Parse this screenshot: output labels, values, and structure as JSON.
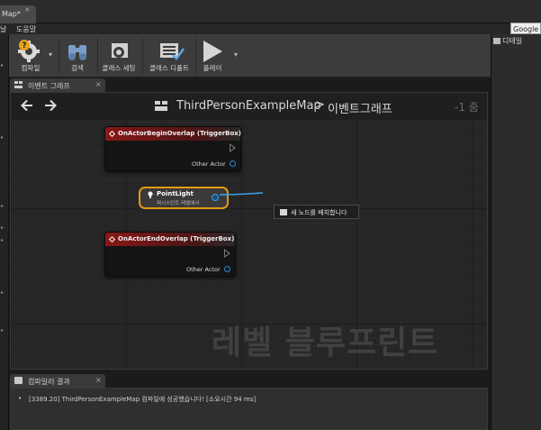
{
  "window": {
    "tab_label": "Map*",
    "tab_close": "×",
    "google_field": "Google"
  },
  "menu": {
    "items": [
      "날",
      "도움말"
    ]
  },
  "toolbar": {
    "buttons": [
      {
        "label": "컴파일",
        "icon": "compile-gear-icon"
      },
      {
        "label": "검색",
        "icon": "binoculars-icon"
      },
      {
        "label": "클래스 세팅",
        "icon": "gear-icon"
      },
      {
        "label": "클래스 디폴트",
        "icon": "checklist-icon"
      },
      {
        "label": "플레이",
        "icon": "play-icon"
      }
    ]
  },
  "details_panel": {
    "tab_label": "디테일"
  },
  "graph_tab": {
    "label": "이벤트 그래프",
    "close": "×"
  },
  "graph": {
    "breadcrumb_map": "ThirdPersonExampleMap",
    "breadcrumb_sep": ">",
    "breadcrumb_graph": "이벤트그래프",
    "zoom": "-1 줌",
    "watermark": "레벨 블루프린트",
    "nodes": {
      "begin_overlap": {
        "title": "OnActorBeginOverlap (TriggerBox)",
        "pin": "Other Actor"
      },
      "point_light": {
        "title": "PointLight",
        "subtitle": "퍼시스턴트 레벨에서"
      },
      "end_overlap": {
        "title": "OnActorEndOverlap (TriggerBox)",
        "pin": "Other Actor"
      }
    },
    "place_node_label": "새 노드를 배치합니다"
  },
  "results": {
    "tab_label": "컴파일러 결과",
    "close": "×",
    "message": "[3389.20] ThirdPersonExampleMap 컴파일에 성공했습니다! [소요시간 94 ms]"
  },
  "colors": {
    "event_header": "#8a1717",
    "selected_border": "#e39a16",
    "object_pin": "#1f8fd8"
  }
}
